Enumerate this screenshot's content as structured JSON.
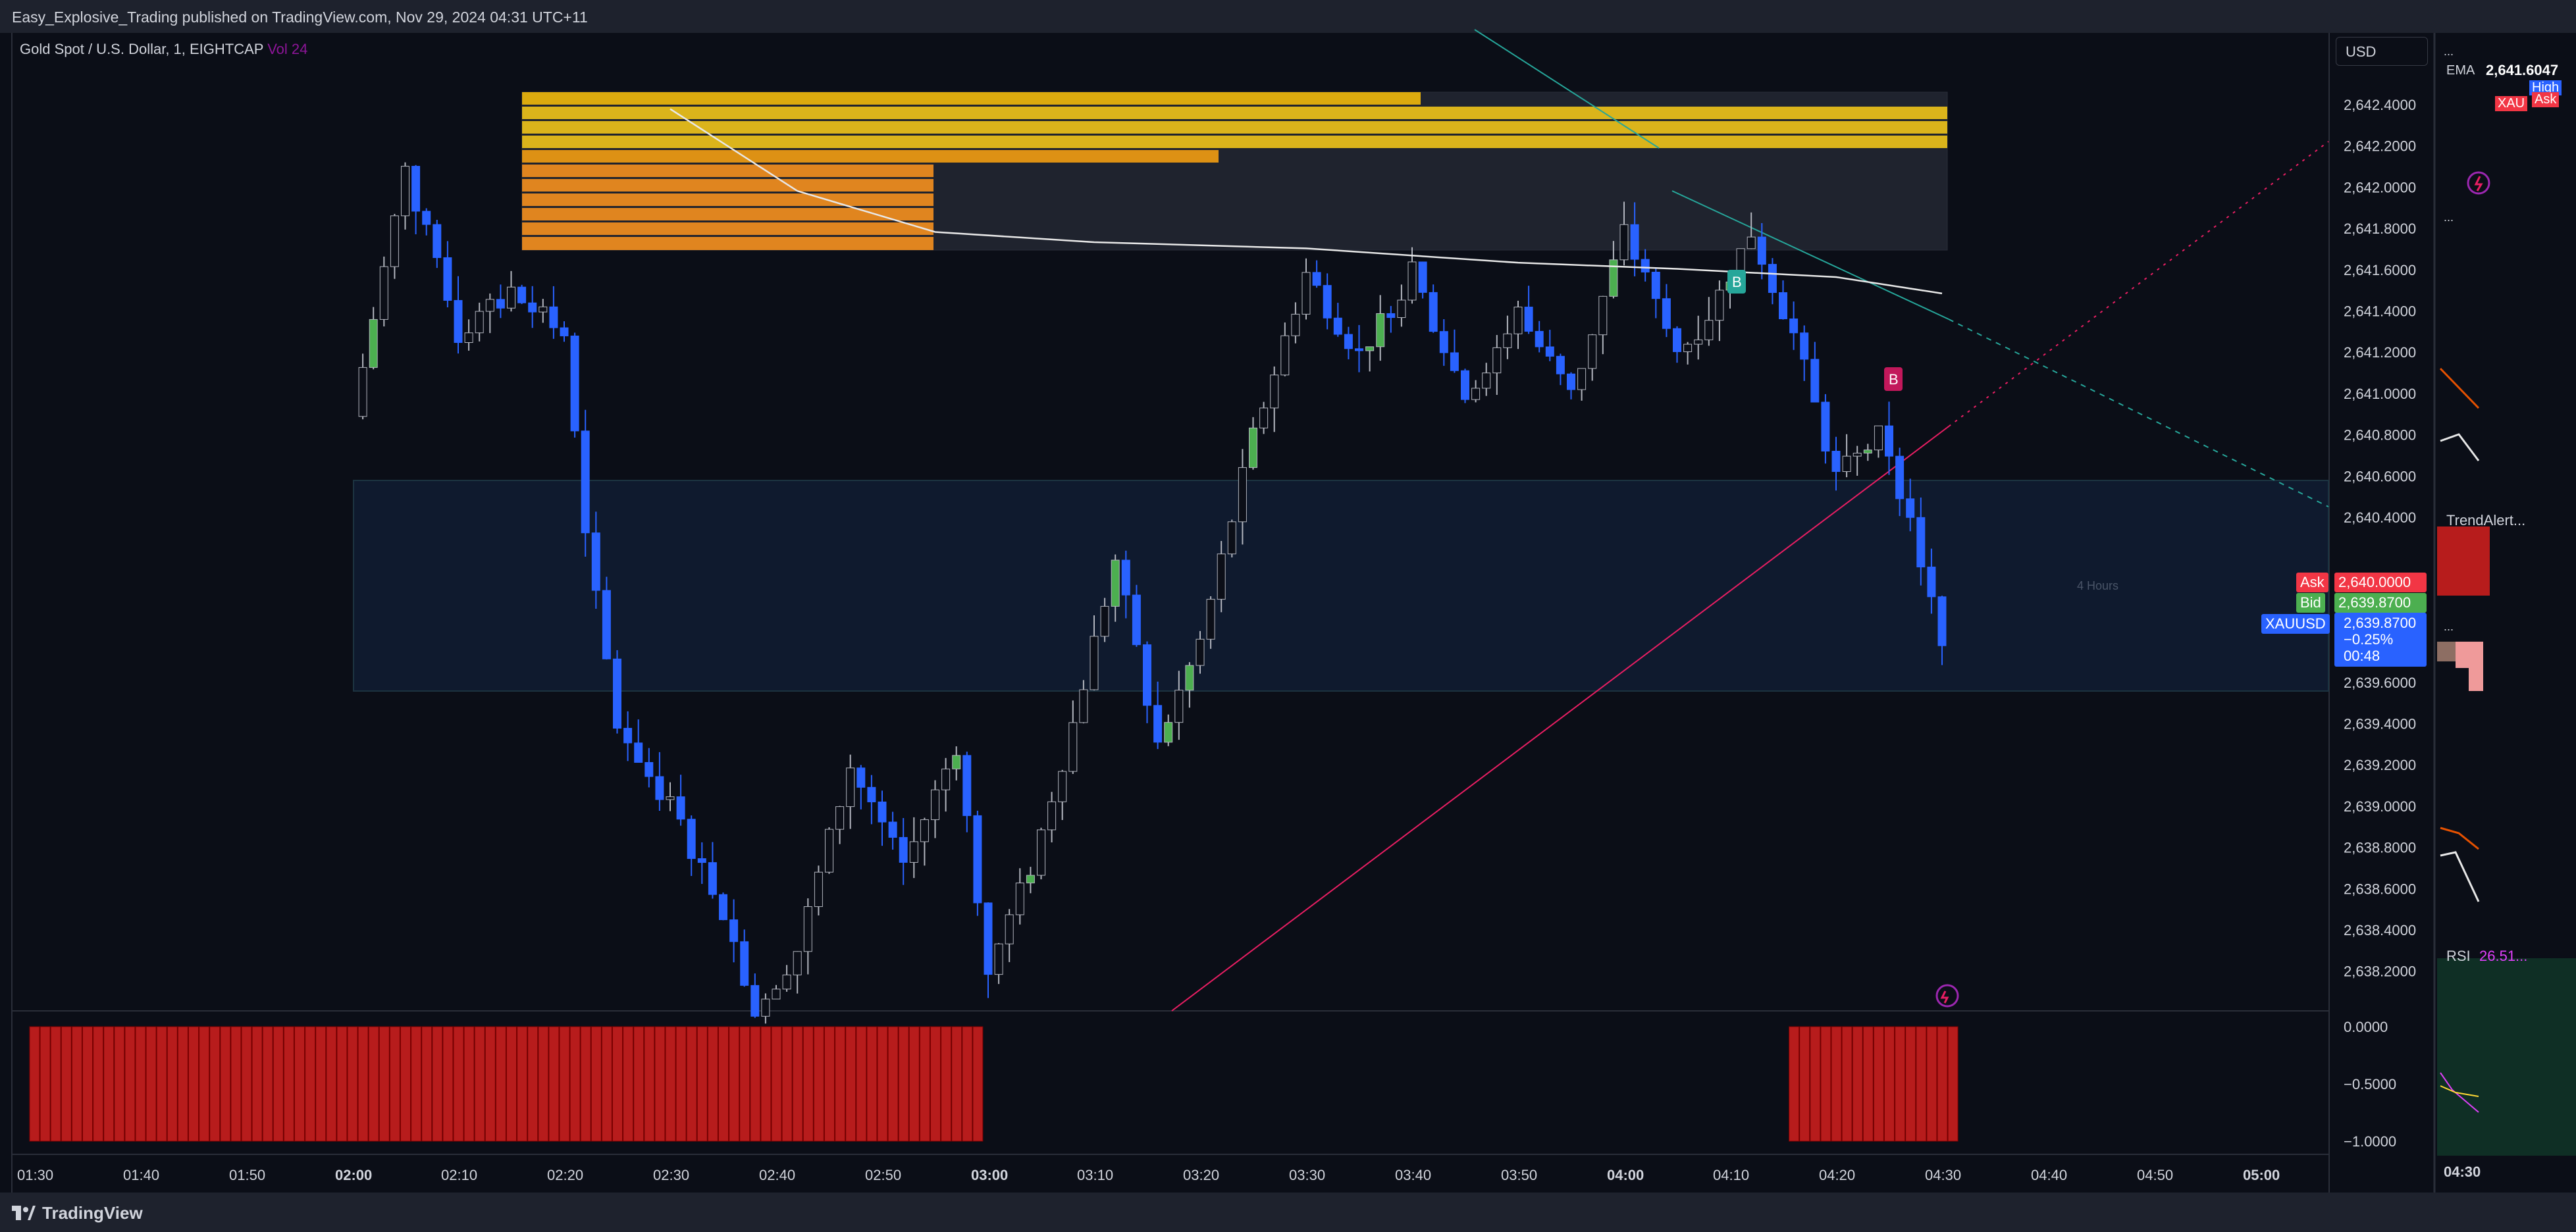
{
  "header": {
    "published_text": "Easy_Explosive_Trading published on TradingView.com, Nov 29, 2024 04:31 UTC+11"
  },
  "legend": {
    "symbol_text": "Gold Spot / U.S. Dollar, 1, EIGHTCAP",
    "vol_text": "Vol 24"
  },
  "currency_selector": {
    "value": "USD"
  },
  "price_axis": {
    "ticks": [
      "2,642.4000",
      "2,642.2000",
      "2,642.0000",
      "2,641.8000",
      "2,641.6000",
      "2,641.4000",
      "2,641.2000",
      "2,641.0000",
      "2,640.8000",
      "2,640.6000",
      "2,640.4000",
      "2,639.6000",
      "2,639.4000",
      "2,639.2000",
      "2,639.0000",
      "2,638.8000",
      "2,638.6000",
      "2,638.4000",
      "2,638.2000"
    ],
    "ask_label": "Ask",
    "ask_value": "2,640.0000",
    "bid_label": "Bid",
    "bid_value": "2,639.8700",
    "symbol_label": "XAUUSD",
    "last_value": "2,639.8700",
    "change": "−0.25%",
    "countdown": "00:48"
  },
  "indicator_axis": {
    "ticks": [
      "0.0000",
      "−0.5000",
      "−1.0000"
    ]
  },
  "time_axis": {
    "ticks": [
      "01:30",
      "01:40",
      "01:50",
      "02:00",
      "02:10",
      "02:20",
      "02:30",
      "02:40",
      "02:50",
      "03:00",
      "03:10",
      "03:20",
      "03:30",
      "03:40",
      "03:50",
      "04:00",
      "04:10",
      "04:20",
      "04:30",
      "04:40",
      "04:50",
      "05:00"
    ]
  },
  "chart_annotations": {
    "session_label": "4 Hours",
    "buy_marker": "B",
    "sell_marker": "B"
  },
  "side_panel": {
    "ema_label": "EMA",
    "ema_value": "2,641.6047",
    "high_tag": "High",
    "xau_tag": "XAU",
    "ask_tag": "Ask",
    "more_1": "...",
    "more_2": "...",
    "more_3": "...",
    "trend_alert": "TrendAlert...",
    "rsi_label": "RSI",
    "rsi_value": "26.51...",
    "time_label": "04:30"
  },
  "footer": {
    "brand": "TradingView"
  },
  "colors": {
    "background": "#0b0e17",
    "bear_candle": "#2962ff",
    "bull_candle": "#4caf50",
    "sell_volume": "#b71c1c",
    "ask": "#f23645",
    "bid": "#4caf50",
    "last": "#2962ff"
  },
  "chart_data": {
    "type": "candlestick",
    "symbol": "XAUUSD",
    "timeframe": "1",
    "ylim": [
      2638.1,
      2642.55
    ],
    "x_ticks": [
      "01:30",
      "01:40",
      "01:50",
      "02:00",
      "02:10",
      "02:20",
      "02:30",
      "02:40",
      "02:50",
      "03:00",
      "03:10",
      "03:20",
      "03:30",
      "03:40",
      "03:50",
      "04:00",
      "04:10",
      "04:20",
      "04:30",
      "04:40",
      "04:50",
      "05:00"
    ],
    "close_path": [
      [
        "02:00",
        2641.0
      ],
      [
        "02:05",
        2642.2
      ],
      [
        "02:10",
        2641.4
      ],
      [
        "02:15",
        2641.6
      ],
      [
        "02:20",
        2641.4
      ],
      [
        "02:22",
        2640.4
      ],
      [
        "02:25",
        2639.5
      ],
      [
        "02:30",
        2639.1
      ],
      [
        "02:35",
        2638.6
      ],
      [
        "02:38",
        2638.1
      ],
      [
        "02:42",
        2638.4
      ],
      [
        "02:47",
        2639.3
      ],
      [
        "02:52",
        2638.8
      ],
      [
        "02:57",
        2639.4
      ],
      [
        "03:00",
        2638.3
      ],
      [
        "03:04",
        2638.8
      ],
      [
        "03:08",
        2639.5
      ],
      [
        "03:12",
        2640.3
      ],
      [
        "03:16",
        2639.4
      ],
      [
        "03:20",
        2639.9
      ],
      [
        "03:25",
        2640.9
      ],
      [
        "03:30",
        2641.7
      ],
      [
        "03:35",
        2641.3
      ],
      [
        "03:40",
        2641.7
      ],
      [
        "03:45",
        2641.1
      ],
      [
        "03:50",
        2641.5
      ],
      [
        "03:55",
        2641.1
      ],
      [
        "04:00",
        2641.9
      ],
      [
        "04:05",
        2641.3
      ],
      [
        "04:08",
        2641.5
      ],
      [
        "04:12",
        2641.9
      ],
      [
        "04:16",
        2641.4
      ],
      [
        "04:20",
        2640.7
      ],
      [
        "04:24",
        2640.9
      ],
      [
        "04:27",
        2640.5
      ],
      [
        "04:30",
        2639.87
      ]
    ],
    "ema": [
      [
        "02:30",
        2642.5
      ],
      [
        "02:42",
        2642.1
      ],
      [
        "02:55",
        2641.9
      ],
      [
        "03:10",
        2641.85
      ],
      [
        "03:30",
        2641.82
      ],
      [
        "03:50",
        2641.75
      ],
      [
        "04:05",
        2641.72
      ],
      [
        "04:20",
        2641.68
      ],
      [
        "04:30",
        2641.6
      ]
    ],
    "indicator_values": {
      "range": [
        -1,
        0
      ],
      "sell_ranges": [
        [
          "01:30",
          "03:00"
        ],
        [
          "04:16",
          "04:32"
        ]
      ],
      "value": -1.0
    }
  }
}
